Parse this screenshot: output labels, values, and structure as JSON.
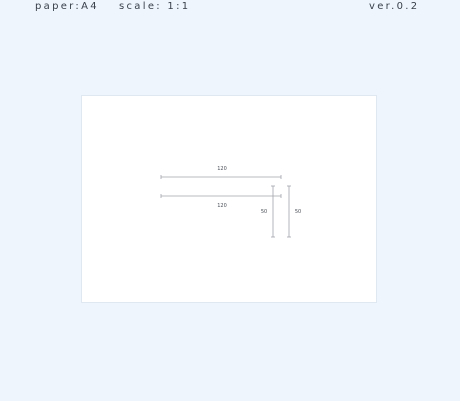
{
  "header": {
    "paper_label": "paper:A4",
    "scale_label": "scale: 1:1",
    "version_label": "ver.0.2"
  },
  "drawing": {
    "dimensions": [
      {
        "id": "top-horizontal",
        "value": "120"
      },
      {
        "id": "bottom-horizontal",
        "value": "120"
      },
      {
        "id": "left-vertical",
        "value": "50"
      },
      {
        "id": "right-vertical",
        "value": "50"
      }
    ]
  },
  "colors": {
    "page_background": "#eef5fd",
    "canvas_background": "#ffffff",
    "dimension_line": "#a0a4aa",
    "text": "#39404a"
  }
}
